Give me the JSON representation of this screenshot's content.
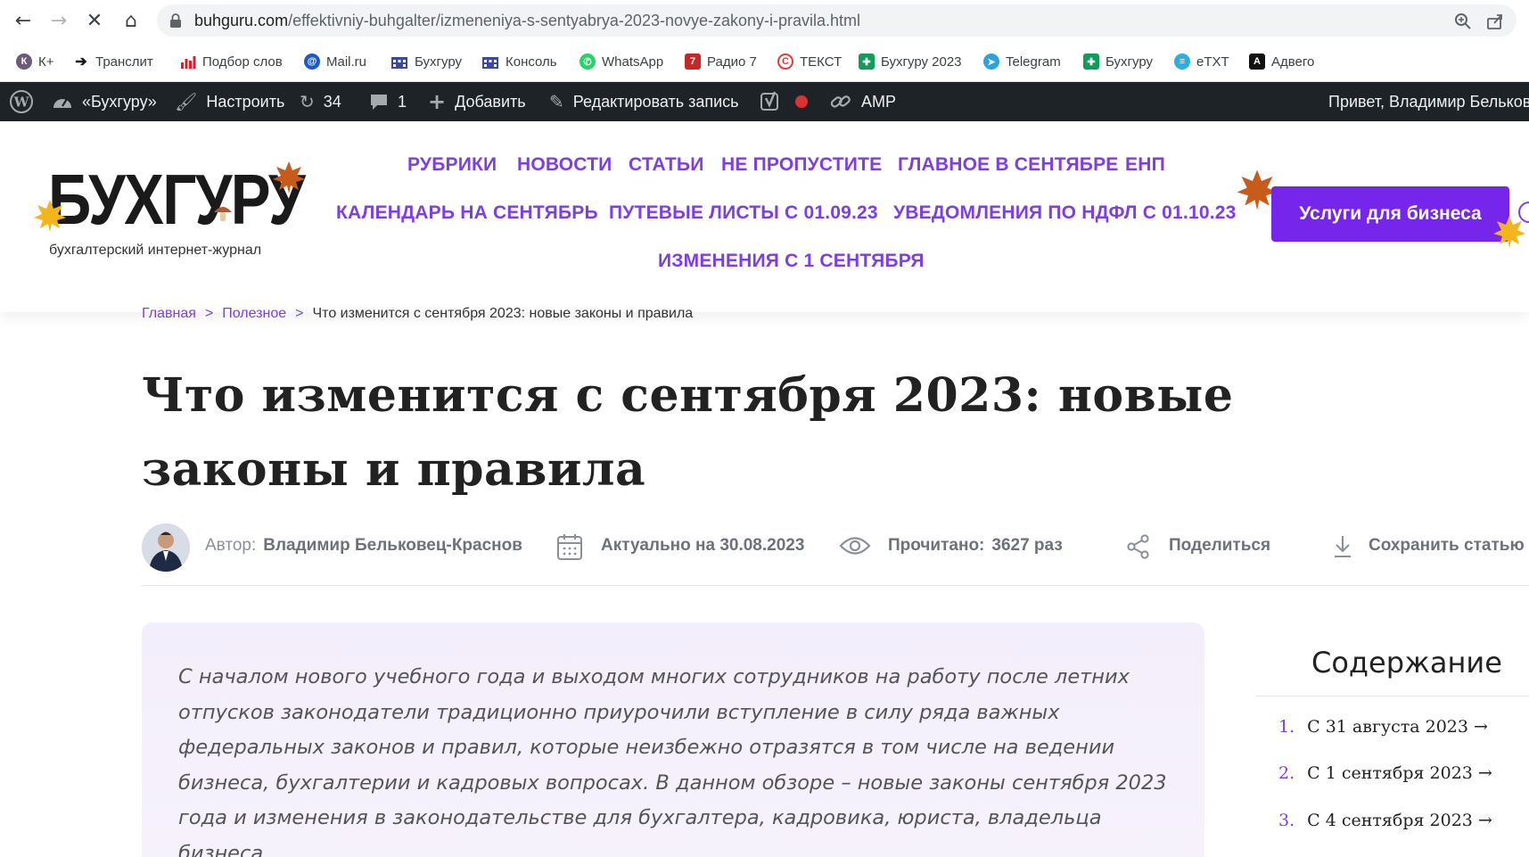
{
  "browser": {
    "url_host": "buhguru.com",
    "url_path": "/effektivniy-buhgalter/izmeneniya-s-sentyabrya-2023-novye-zakony-i-pravila.html"
  },
  "bookmarks": [
    {
      "label": "К+",
      "icon": "kplus-icon",
      "color": "#5a4a6a"
    },
    {
      "label": "Транслит",
      "icon": "translit-icon",
      "color": "#1a1a1a"
    },
    {
      "label": "Подбор слов",
      "icon": "bars-icon",
      "color": "#d9202a"
    },
    {
      "label": "Mail.ru",
      "icon": "mailru-icon",
      "color": "#1e5bc6"
    },
    {
      "label": "Бухгуру",
      "icon": "building-icon",
      "color": "#3b4a9c"
    },
    {
      "label": "Консоль",
      "icon": "building-icon",
      "color": "#3b4a9c"
    },
    {
      "label": "WhatsApp",
      "icon": "whatsapp-icon",
      "color": "#25d366"
    },
    {
      "label": "Радио 7",
      "icon": "radio7-icon",
      "color": "#c62828"
    },
    {
      "label": "ТЕКСТ",
      "icon": "copyright-icon",
      "color": "#e53935"
    },
    {
      "label": "Бухгуру 2023",
      "icon": "sheets-icon",
      "color": "#0f9d58"
    },
    {
      "label": "Telegram",
      "icon": "telegram-icon",
      "color": "#2aa3df"
    },
    {
      "label": "Бухгуру",
      "icon": "sheets-icon",
      "color": "#0f9d58"
    },
    {
      "label": "eTXT",
      "icon": "etxt-icon",
      "color": "#2ab0e0"
    },
    {
      "label": "Адвего",
      "icon": "advego-icon",
      "color": "#111111"
    }
  ],
  "wpbar": {
    "site": "«Бухгуру»",
    "customize": "Настроить",
    "updates": "34",
    "comments": "1",
    "add": "Добавить",
    "edit": "Редактировать запись",
    "amp": "AMP",
    "greeting": "Привет, Владимир Бельков"
  },
  "logo": {
    "name": "БУХГУРУ",
    "tagline": "бухгалтерский интернет-журнал"
  },
  "menu": {
    "row1": [
      "РУБРИКИ",
      "НОВОСТИ",
      "СТАТЬИ",
      "НЕ ПРОПУСТИТЕ",
      "ГЛАВНОЕ В СЕНТЯБРЕ",
      "ЕНП"
    ],
    "row2": [
      "КАЛЕНДАРЬ НА СЕНТЯБРЬ",
      "ПУТЕВЫЕ ЛИСТЫ С 01.09.23",
      "УВЕДОМЛЕНИЯ ПО НДФЛ С 01.10.23"
    ],
    "row3": [
      "ИЗМЕНЕНИЯ С 1 СЕНТЯБРЯ"
    ],
    "cta": "Услуги для бизнеса"
  },
  "breadcrumb": {
    "home": "Главная",
    "section": "Полезное",
    "sep": ">",
    "current": "Что изменится с сентября 2023: новые законы и правила"
  },
  "article": {
    "title": "Что изменится с сентября 2023: новые законы и правила",
    "author_label": "Автор:",
    "author": "Владимир Бельковец-Краснов",
    "actual": "Актуально на 30.08.2023",
    "read_label": "Прочитано:",
    "read_count": "3627 раз",
    "share": "Поделиться",
    "save": "Сохранить статью",
    "intro": "С началом нового учебного года и выходом многих сотрудников на работу после летних отпусков законодатели традиционно приурочили вступление в силу ряда важных федеральных законов и правил, которые неизбежно отразятся в том числе на ведении бизнеса, бухгалтерии и кадровых вопросах. В данном обзоре – новые законы сентября 2023 года и изменения в законодательстве для бухгалтера, кадровика, юриста, владельца бизнеса."
  },
  "toc": {
    "title": "Содержание",
    "items": [
      {
        "num": "1.",
        "label": "С 31 августа 2023 →"
      },
      {
        "num": "2.",
        "label": "С 1 сентября 2023 →"
      },
      {
        "num": "3.",
        "label": "С 4 сентября 2023 →"
      }
    ]
  },
  "colors": {
    "accent": "#7b3fe4",
    "cta": "#7526ea",
    "wpbar": "#1d2327",
    "intro_bg": "#f3eefb"
  }
}
